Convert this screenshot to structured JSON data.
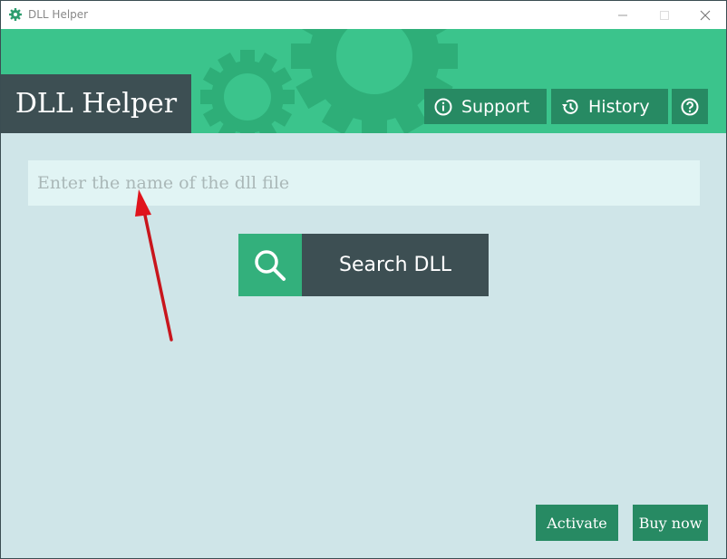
{
  "window": {
    "title": "DLL Helper",
    "app_icon": "gear-icon",
    "controls": {
      "minimize": "minimize-icon",
      "maximize": "maximize-icon",
      "close": "close-icon"
    }
  },
  "header": {
    "brand": "DLL Helper",
    "buttons": {
      "support": {
        "label": "Support",
        "icon": "info-icon"
      },
      "history": {
        "label": "History",
        "icon": "history-icon"
      },
      "help": {
        "label": "",
        "icon": "question-icon"
      }
    }
  },
  "search": {
    "input_value": "",
    "placeholder": "Enter the name of the dll file",
    "button_label": "Search DLL",
    "button_icon": "search-icon"
  },
  "footer": {
    "activate_label": "Activate",
    "buy_label": "Buy now"
  },
  "colors": {
    "header_green": "#3bc48c",
    "button_green": "#278a63",
    "dark_slate": "#3d4f53",
    "background": "#cfe5e8",
    "input_bg": "#e1f4f4"
  }
}
